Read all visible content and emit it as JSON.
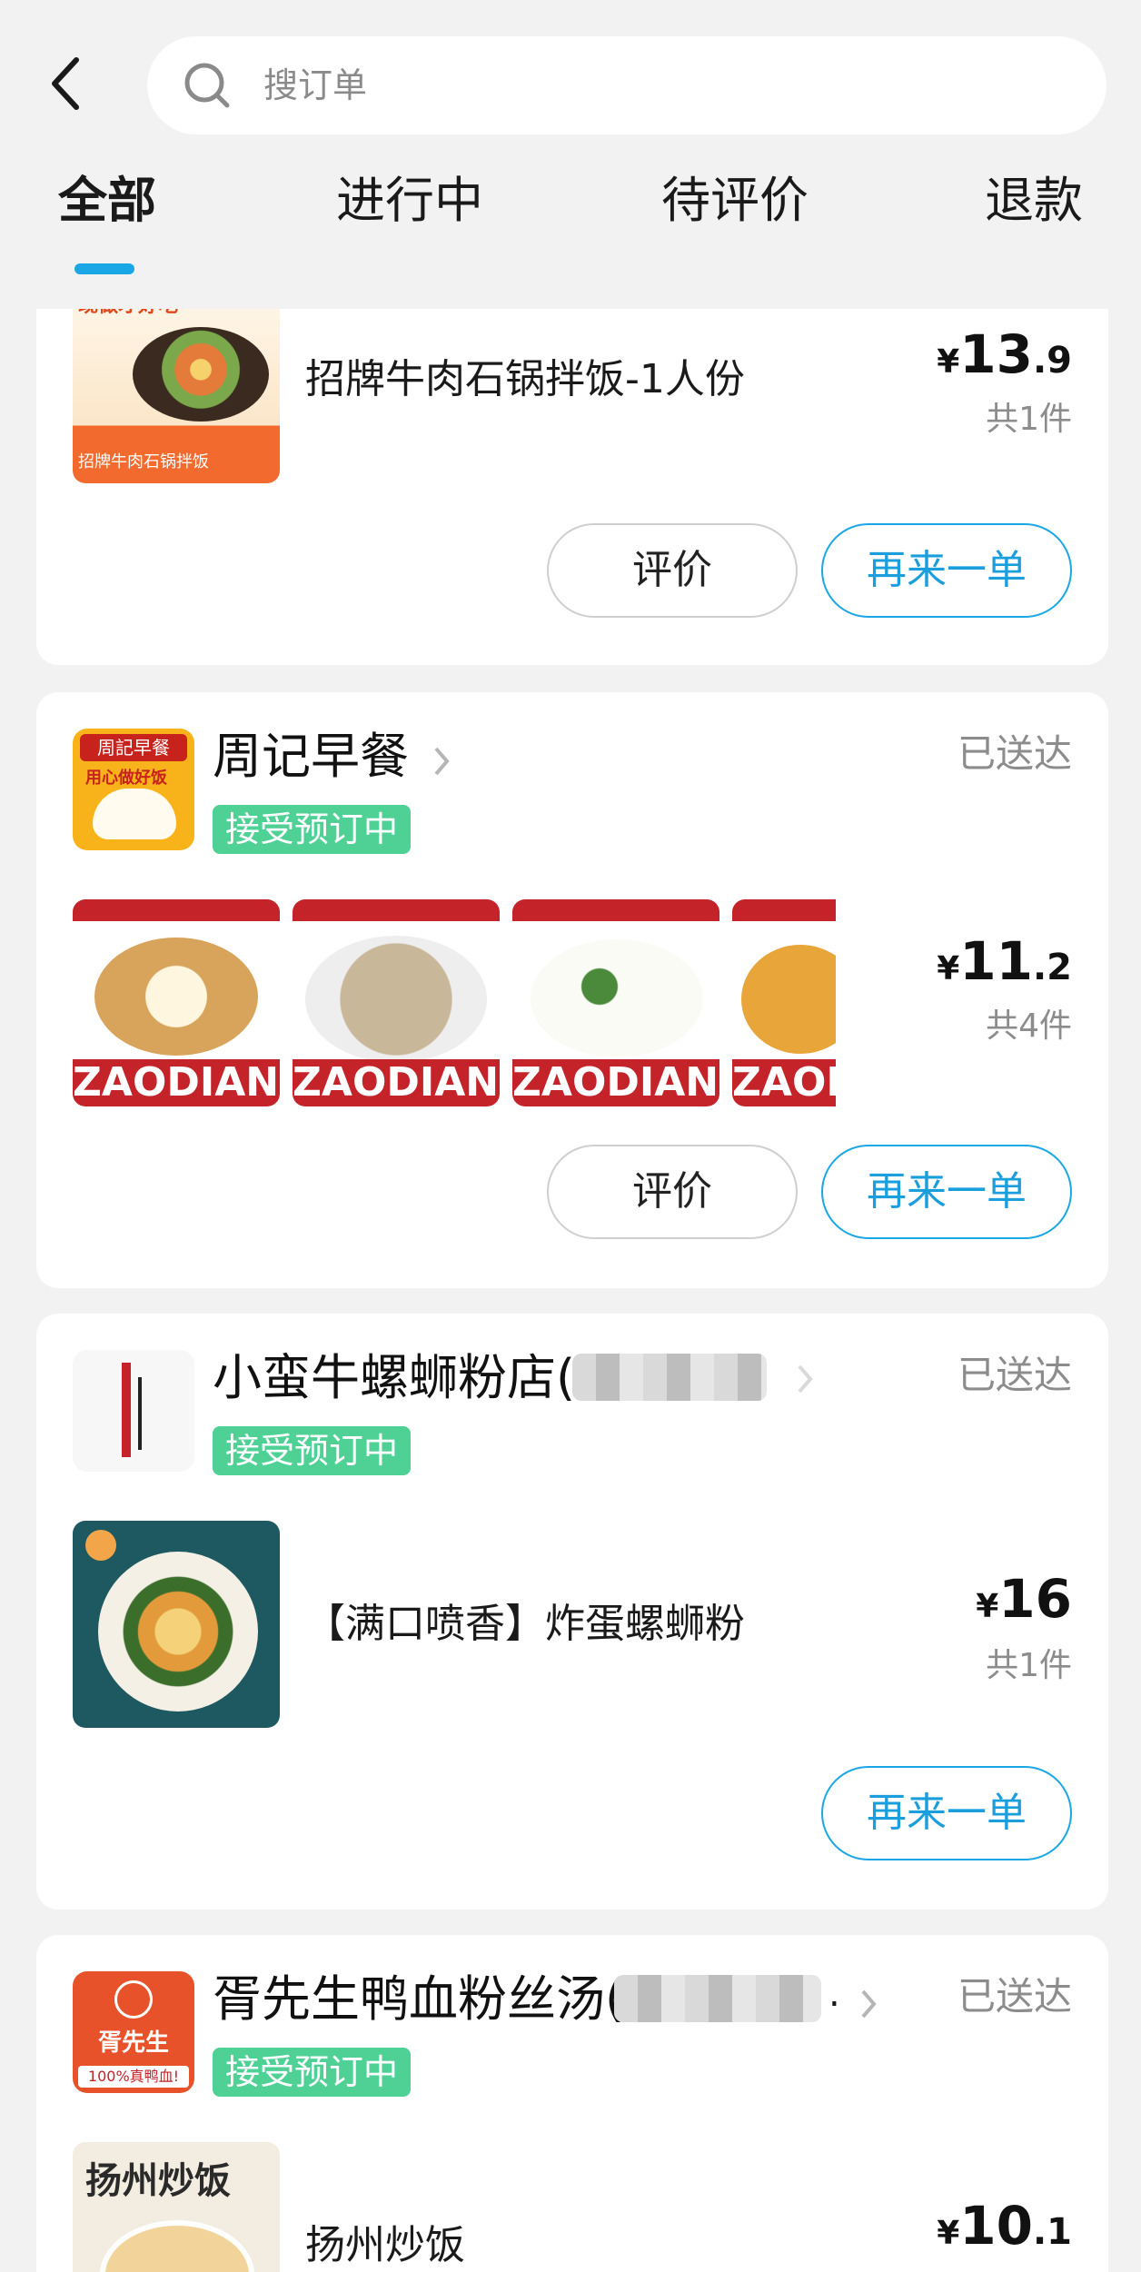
{
  "search": {
    "placeholder": "搜订单"
  },
  "tabs": [
    {
      "label": "全部"
    },
    {
      "label": "进行中"
    },
    {
      "label": "待评价"
    },
    {
      "label": "退款"
    }
  ],
  "orders": [
    {
      "product_name": "招牌牛肉石锅拌饭-1人份",
      "thumb_text_top": "现做才好吃",
      "thumb_text_bottom": "招牌牛肉石锅拌饭",
      "price_currency": "¥",
      "price_int": "13",
      "price_dec": ".9",
      "count": "共1件",
      "rate_label": "评价",
      "again_label": "再来一单"
    },
    {
      "shop_name": "周记早餐",
      "logo_text_top": "周記早餐",
      "logo_text_mid": "用心做好饭",
      "status": "已送达",
      "badge": "接受预订中",
      "item_banner": "ZAODIAN",
      "price_currency": "¥",
      "price_int": "11",
      "price_dec": ".2",
      "count": "共4件",
      "rate_label": "评价",
      "again_label": "再来一单"
    },
    {
      "shop_name": "小蛮牛螺蛳粉店(",
      "status": "已送达",
      "badge": "接受预订中",
      "product_name": "【满口喷香】炸蛋螺蛳粉",
      "price_currency": "¥",
      "price_int": "16",
      "price_dec": "",
      "count": "共1件",
      "again_label": "再来一单"
    },
    {
      "shop_name": "胥先生鸭血粉丝汤(",
      "shop_name_tail": ".",
      "logo_text_top": "胥先生",
      "logo_text_bottom": "100%真鸭血!",
      "status": "已送达",
      "badge": "接受预订中",
      "product_name": "扬州炒饭",
      "thumb_text": "扬州炒饭",
      "price_currency": "¥",
      "price_int": "10",
      "price_dec": ".1"
    }
  ],
  "colors": {
    "accent": "#1aa7e6",
    "badge": "#4fd196"
  }
}
